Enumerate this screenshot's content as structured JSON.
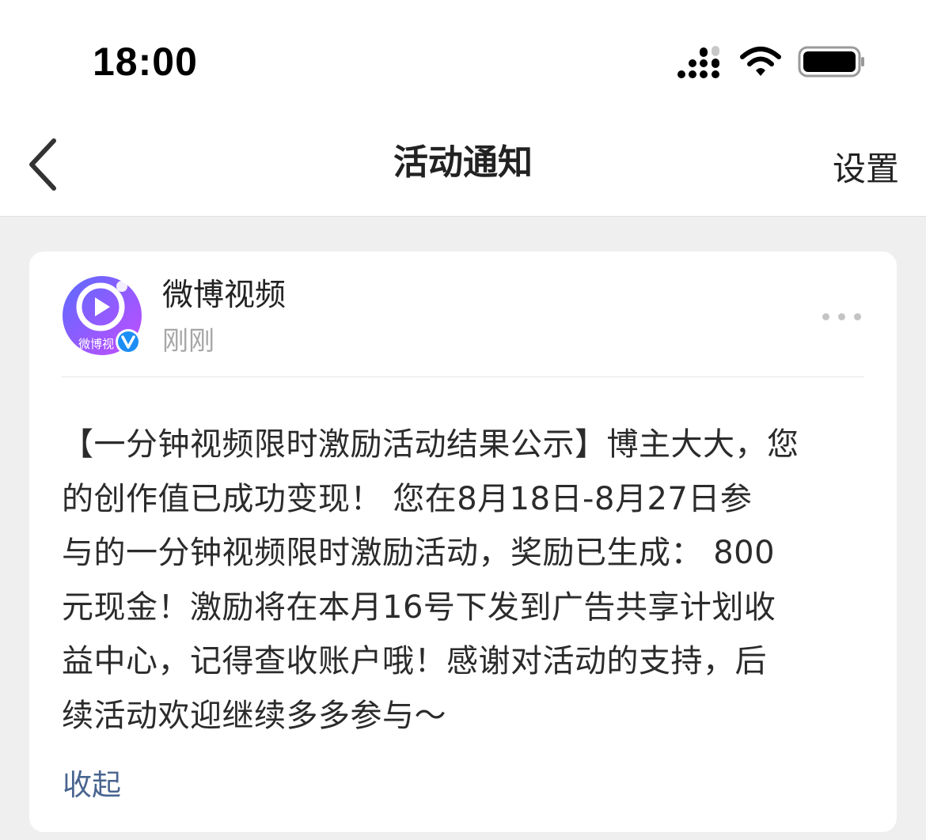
{
  "status_bar": {
    "time": "18:00",
    "icons": [
      "signal-icon",
      "wifi-icon",
      "battery-icon"
    ]
  },
  "nav": {
    "back_icon": "chevron-left-icon",
    "title": "活动通知",
    "settings_label": "设置"
  },
  "message": {
    "sender_name": "微博视频",
    "timestamp": "刚刚",
    "avatar_text": "微博视",
    "verified_badge": "V",
    "more_icon": "more-horizontal-icon",
    "body_lines": [
      "【一分钟视频限时激励活动结果公示】博主大大，您",
      "的创作值已成功变现！ 您在8月18日-8月27日参",
      "与的一分钟视频限时激励活动，奖励已生成： 800",
      "元现金！激励将在本月16号下发到广告共享计划收",
      "益中心，记得查收账户哦！感谢对活动的支持，后",
      "续活动欢迎继续多多参与～"
    ],
    "collapse_label": "收起"
  },
  "colors": {
    "background": "#efefef",
    "card": "#ffffff",
    "link": "#4a6590",
    "verified": "#1d8ef5",
    "avatar_gradient_start": "#6b3cff",
    "avatar_gradient_end": "#c44dff"
  }
}
